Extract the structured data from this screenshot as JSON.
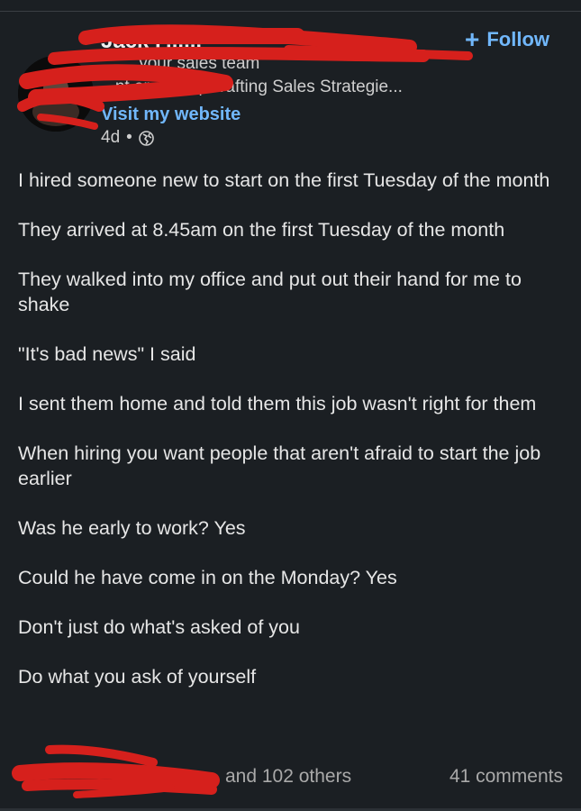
{
  "post": {
    "author_name": "Jack F......",
    "headline_line1": "....... your sales team",
    "headline_line2": "...nt or won't | Crafting Sales Strategie...",
    "website_link": "Visit my website",
    "time_ago": "4d",
    "meta_separator": "•",
    "follow_label": "Follow",
    "follow_plus": "+",
    "body_paragraphs": [
      "I hired someone new to start on the first Tuesday of the month",
      "They arrived at 8.45am on the first Tuesday of the month",
      "They walked into my office and put out their hand for me to shake",
      "\"It's bad news\" I said",
      "I sent them home and told them this job wasn't right for them",
      "When hiring you want people that aren't afraid to start the job earlier",
      "Was he early to work? Yes",
      "Could he have come in on the Monday? Yes",
      "Don't just do what's asked of you",
      "Do what you ask of yourself"
    ],
    "reactions_text": "and 102 others",
    "comments_text": "41 comments"
  },
  "colors": {
    "background": "#1b1f23",
    "link_blue": "#71b7fb",
    "redaction_red": "#d6201c"
  }
}
